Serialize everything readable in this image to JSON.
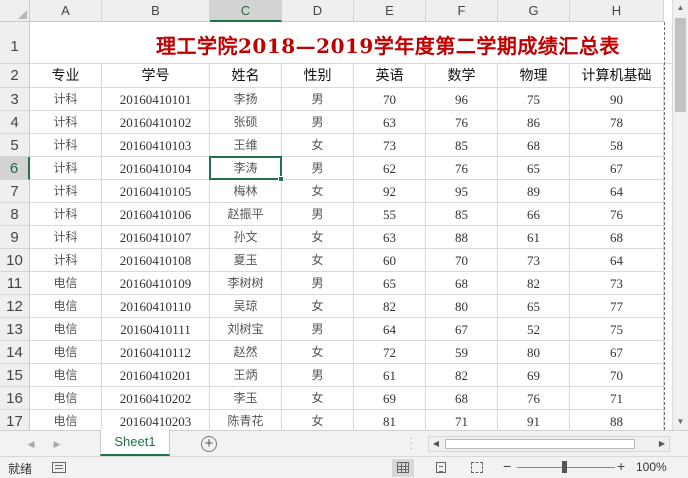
{
  "sheet": {
    "columns": [
      "A",
      "B",
      "C",
      "D",
      "E",
      "F",
      "G",
      "H"
    ],
    "selected_column": "C",
    "selected_row": 6,
    "title": "理工学院2018—2019学年度第二学期成绩汇总表",
    "headers": [
      "专业",
      "学号",
      "姓名",
      "性别",
      "英语",
      "数学",
      "物理",
      "计算机基础"
    ],
    "rows": [
      [
        "计科",
        "20160410101",
        "李扬",
        "男",
        "70",
        "96",
        "75",
        "90"
      ],
      [
        "计科",
        "20160410102",
        "张硕",
        "男",
        "63",
        "76",
        "86",
        "78"
      ],
      [
        "计科",
        "20160410103",
        "王维",
        "女",
        "73",
        "85",
        "68",
        "58"
      ],
      [
        "计科",
        "20160410104",
        "李涛",
        "男",
        "62",
        "76",
        "65",
        "67"
      ],
      [
        "计科",
        "20160410105",
        "梅林",
        "女",
        "92",
        "95",
        "89",
        "64"
      ],
      [
        "计科",
        "20160410106",
        "赵振平",
        "男",
        "55",
        "85",
        "66",
        "76"
      ],
      [
        "计科",
        "20160410107",
        "孙文",
        "女",
        "63",
        "88",
        "61",
        "68"
      ],
      [
        "计科",
        "20160410108",
        "夏玉",
        "女",
        "60",
        "70",
        "73",
        "64"
      ],
      [
        "电信",
        "20160410109",
        "李树树",
        "男",
        "65",
        "68",
        "82",
        "73"
      ],
      [
        "电信",
        "20160410110",
        "吴琼",
        "女",
        "82",
        "80",
        "65",
        "77"
      ],
      [
        "电信",
        "20160410111",
        "刘树宝",
        "男",
        "64",
        "67",
        "52",
        "75"
      ],
      [
        "电信",
        "20160410112",
        "赵然",
        "女",
        "72",
        "59",
        "80",
        "67"
      ],
      [
        "电信",
        "20160410201",
        "王炳",
        "男",
        "61",
        "82",
        "69",
        "70"
      ],
      [
        "电信",
        "20160410202",
        "李玉",
        "女",
        "69",
        "68",
        "76",
        "71"
      ],
      [
        "电信",
        "20160410203",
        "陈青花",
        "女",
        "81",
        "71",
        "91",
        "88"
      ]
    ],
    "row_numbers": [
      "1",
      "2",
      "3",
      "4",
      "5",
      "6",
      "7",
      "8",
      "9",
      "10",
      "11",
      "12",
      "13",
      "14",
      "15",
      "16",
      "17"
    ]
  },
  "tabs": {
    "sheet_name": "Sheet1",
    "add_label": "+",
    "prev_arrow": "◀",
    "next_arrow": "▶"
  },
  "status": {
    "ready_text": "就绪",
    "zoom_minus": "−",
    "zoom_plus": "+",
    "zoom_level": "100%"
  },
  "colors": {
    "title": "#c00000",
    "accent": "#217346"
  }
}
